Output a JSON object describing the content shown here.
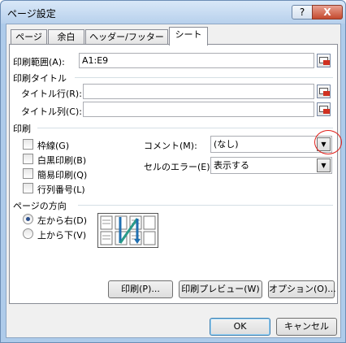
{
  "window": {
    "title": "ページ設定",
    "help_button": "?",
    "close_button": "X"
  },
  "tabs": [
    {
      "label": "ページ"
    },
    {
      "label": "余白"
    },
    {
      "label": "ヘッダー/フッター"
    },
    {
      "label": "シート"
    }
  ],
  "print_area": {
    "label": "印刷範囲(A):",
    "value": "A1:E9"
  },
  "print_titles": {
    "heading": "印刷タイトル",
    "rows_label": "タイトル行(R):",
    "rows_value": "",
    "cols_label": "タイトル列(C):",
    "cols_value": ""
  },
  "print": {
    "heading": "印刷",
    "gridlines": "枠線(G)",
    "black_white": "白黒印刷(B)",
    "draft": "簡易印刷(Q)",
    "row_col_headers": "行列番号(L)",
    "comments_label": "コメント(M):",
    "comments_value": "(なし)",
    "errors_label": "セルのエラー(E):",
    "errors_value": "表示する"
  },
  "page_order": {
    "heading": "ページの方向",
    "down_then_over": "左から右(D)",
    "over_then_down": "上から下(V)",
    "selected": "左から右(D)"
  },
  "buttons": {
    "print": "印刷(P)...",
    "print_preview": "印刷プレビュー(W)",
    "options": "オプション(O)...",
    "ok": "OK",
    "cancel": "キャンセル"
  },
  "colors": {
    "highlight_circle": "#e0201a",
    "title_gradient": "#b7d0ec"
  }
}
